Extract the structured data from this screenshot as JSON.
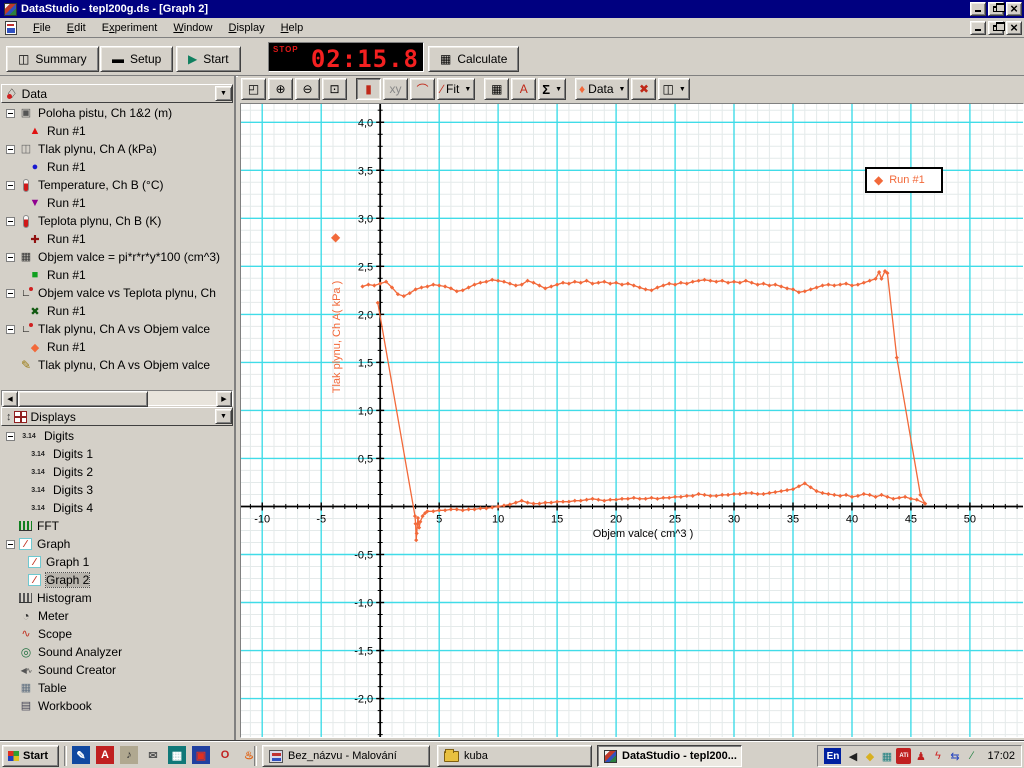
{
  "window": {
    "title": "DataStudio - tepl200g.ds - [Graph 2]"
  },
  "menu": {
    "items": [
      "File",
      "Edit",
      "Experiment",
      "Window",
      "Display",
      "Help"
    ]
  },
  "toolbar": {
    "summary_label": "Summary",
    "setup_label": "Setup",
    "start_label": "Start",
    "calculate_label": "Calculate",
    "timer": {
      "mode": "STOP",
      "value": "02:15.8"
    }
  },
  "graph_toolbar": {
    "fit_label": "Fit",
    "data_label": "Data",
    "buttons": [
      {
        "name": "scale-to-fit-button"
      },
      {
        "name": "zoom-in-button"
      },
      {
        "name": "zoom-out-button"
      },
      {
        "name": "zoom-select-button"
      },
      {
        "name": "smart-tool-button",
        "pressed": true,
        "gap": true
      },
      {
        "name": "xy-tool-button",
        "disabled": true
      },
      {
        "name": "slope-tool-button"
      },
      {
        "name": "fit-dropdown",
        "dropdown": true,
        "label_key": "fit_label"
      },
      {
        "name": "calculate-tool-button",
        "gap": true
      },
      {
        "name": "text-tool-button"
      },
      {
        "name": "statistics-dropdown",
        "dropdown": true
      },
      {
        "name": "data-dropdown",
        "dropdown": true,
        "label_key": "data_label",
        "gap": true
      },
      {
        "name": "delete-button"
      },
      {
        "name": "settings-dropdown",
        "dropdown": true
      }
    ]
  },
  "sidebar": {
    "data_panel": {
      "title": "Data",
      "tree": [
        {
          "icon": "motion-sensor",
          "label": "Poloha pistu, Ch 1&2 (m)",
          "runs": [
            {
              "marker": "triangle-up",
              "color": "#e01010",
              "label": "Run #1"
            }
          ]
        },
        {
          "icon": "pressure-sensor",
          "label": "Tlak plynu, Ch A (kPa)",
          "runs": [
            {
              "marker": "circle",
              "color": "#1818d0",
              "label": "Run #1"
            }
          ]
        },
        {
          "icon": "thermometer",
          "label": "Temperature, Ch B (°C)",
          "runs": [
            {
              "marker": "triangle-down",
              "color": "#900090",
              "label": "Run #1"
            }
          ]
        },
        {
          "icon": "thermometer",
          "label": "Teplota plynu, Ch B (K)",
          "runs": [
            {
              "marker": "plus",
              "color": "#901010",
              "label": "Run #1"
            }
          ]
        },
        {
          "icon": "calculator",
          "label": "Objem valce = pi*r*r*y*100 (cm^3)",
          "runs": [
            {
              "marker": "square",
              "color": "#10a020",
              "label": "Run #1"
            }
          ]
        },
        {
          "icon": "xy-plot",
          "label": "Objem valce vs Teplota plynu, Ch",
          "runs": [
            {
              "marker": "x",
              "color": "#105810",
              "label": "Run #1"
            }
          ]
        },
        {
          "icon": "xy-plot",
          "label": "Tlak plynu, Ch A vs Objem valce",
          "runs": [
            {
              "marker": "diamond",
              "color": "#f2693a",
              "label": "Run #1"
            }
          ]
        },
        {
          "icon": "pencil",
          "label": "Tlak plynu, Ch A vs Objem valce",
          "runs": []
        }
      ]
    },
    "displays_panel": {
      "title": "Displays",
      "tree": [
        {
          "icon": "digits",
          "label": "Digits",
          "children": [
            "Digits 1",
            "Digits 2",
            "Digits 3",
            "Digits 4"
          ]
        },
        {
          "icon": "fft",
          "label": "FFT"
        },
        {
          "icon": "graph",
          "label": "Graph",
          "children": [
            "Graph 1",
            "Graph 2"
          ],
          "selected_child": "Graph 2"
        },
        {
          "icon": "histogram",
          "label": "Histogram"
        },
        {
          "icon": "meter",
          "label": "Meter"
        },
        {
          "icon": "scope",
          "label": "Scope"
        },
        {
          "icon": "sound-analyzer",
          "label": "Sound Analyzer"
        },
        {
          "icon": "sound-creator",
          "label": "Sound Creator"
        },
        {
          "icon": "table",
          "label": "Table"
        },
        {
          "icon": "workbook",
          "label": "Workbook"
        }
      ]
    }
  },
  "chart_data": {
    "type": "scatter",
    "title": "",
    "xlabel": "Objem valce( cm^3 )",
    "ylabel": "Tlak plynu, Ch A( kPa )",
    "xlim": [
      -11.8,
      54.5
    ],
    "ylim": [
      -2.4,
      4.19
    ],
    "x_ticks": {
      "values": [
        -10,
        -5,
        5,
        10,
        15,
        20,
        25,
        30,
        35,
        40,
        45,
        50
      ],
      "labels": [
        "-10",
        "-5",
        "5",
        "10",
        "15",
        "20",
        "25",
        "30",
        "35",
        "40",
        "45",
        "50"
      ]
    },
    "y_ticks": {
      "values": [
        4,
        3.5,
        3,
        2.5,
        2,
        1.5,
        1,
        0.5,
        -0.5,
        -1,
        -1.5,
        -2
      ],
      "labels": [
        "4,0",
        "3,5",
        "3,0",
        "2,5",
        "2,0",
        "1,5",
        "1,0",
        "0,5",
        "-0,5",
        "-1,0",
        "-1,5",
        "-2,0"
      ]
    },
    "grid": {
      "x_major_step": 5,
      "x_minor_step": 1,
      "y_major_step": 0.5,
      "y_minor_step": 0.125,
      "major_color": "#40dce8",
      "minor_color": "#e4eaea"
    },
    "legend": {
      "label": "Run #1",
      "position": "top-right"
    },
    "series": [
      {
        "name": "Run #1",
        "color": "#f2693a",
        "marker": "diamond",
        "points": [
          [
            -1.5,
            2.29
          ],
          [
            -1.0,
            2.31
          ],
          [
            -0.5,
            2.3
          ],
          [
            0.0,
            2.32
          ],
          [
            0.5,
            2.34
          ],
          [
            1.0,
            2.28
          ],
          [
            1.5,
            2.21
          ],
          [
            2.0,
            2.19
          ],
          [
            2.5,
            2.22
          ],
          [
            3.0,
            2.26
          ],
          [
            3.5,
            2.28
          ],
          [
            4.0,
            2.29
          ],
          [
            4.5,
            2.31
          ],
          [
            5.0,
            2.3
          ],
          [
            5.5,
            2.29
          ],
          [
            6.0,
            2.27
          ],
          [
            6.5,
            2.24
          ],
          [
            7.0,
            2.25
          ],
          [
            7.5,
            2.28
          ],
          [
            8.0,
            2.31
          ],
          [
            8.5,
            2.33
          ],
          [
            9.0,
            2.34
          ],
          [
            9.5,
            2.36
          ],
          [
            10.0,
            2.35
          ],
          [
            10.5,
            2.34
          ],
          [
            11.0,
            2.32
          ],
          [
            11.5,
            2.3
          ],
          [
            12.0,
            2.31
          ],
          [
            12.5,
            2.35
          ],
          [
            13.0,
            2.33
          ],
          [
            13.5,
            2.3
          ],
          [
            14.0,
            2.27
          ],
          [
            14.5,
            2.29
          ],
          [
            15.0,
            2.31
          ],
          [
            15.5,
            2.33
          ],
          [
            16.0,
            2.32
          ],
          [
            16.5,
            2.34
          ],
          [
            17.0,
            2.33
          ],
          [
            17.5,
            2.35
          ],
          [
            18.0,
            2.32
          ],
          [
            18.5,
            2.33
          ],
          [
            19.0,
            2.34
          ],
          [
            19.5,
            2.32
          ],
          [
            20.0,
            2.33
          ],
          [
            20.5,
            2.31
          ],
          [
            21.0,
            2.32
          ],
          [
            21.5,
            2.3
          ],
          [
            22.0,
            2.28
          ],
          [
            22.5,
            2.26
          ],
          [
            23.0,
            2.25
          ],
          [
            23.5,
            2.28
          ],
          [
            24.0,
            2.3
          ],
          [
            24.5,
            2.32
          ],
          [
            25.0,
            2.31
          ],
          [
            25.5,
            2.33
          ],
          [
            26.0,
            2.32
          ],
          [
            26.5,
            2.34
          ],
          [
            27.0,
            2.35
          ],
          [
            27.5,
            2.36
          ],
          [
            28.0,
            2.35
          ],
          [
            28.5,
            2.34
          ],
          [
            29.0,
            2.35
          ],
          [
            29.5,
            2.33
          ],
          [
            30.0,
            2.34
          ],
          [
            30.5,
            2.33
          ],
          [
            31.0,
            2.35
          ],
          [
            31.5,
            2.33
          ],
          [
            32.0,
            2.31
          ],
          [
            32.5,
            2.32
          ],
          [
            33.0,
            2.3
          ],
          [
            33.5,
            2.31
          ],
          [
            34.0,
            2.29
          ],
          [
            34.5,
            2.27
          ],
          [
            35.0,
            2.26
          ],
          [
            35.5,
            2.23
          ],
          [
            36.0,
            2.24
          ],
          [
            36.5,
            2.26
          ],
          [
            37.0,
            2.28
          ],
          [
            37.5,
            2.3
          ],
          [
            38.0,
            2.31
          ],
          [
            38.5,
            2.3
          ],
          [
            39.0,
            2.31
          ],
          [
            39.5,
            2.32
          ],
          [
            40.0,
            2.3
          ],
          [
            40.5,
            2.31
          ],
          [
            41.0,
            2.33
          ],
          [
            41.5,
            2.35
          ],
          [
            42.0,
            2.37
          ],
          [
            42.3,
            2.44
          ],
          [
            42.5,
            2.37
          ],
          [
            42.8,
            2.45
          ],
          [
            43.0,
            2.43
          ],
          [
            43.8,
            1.55
          ],
          [
            45.8,
            0.12
          ],
          [
            46.2,
            0.03
          ],
          [
            45.5,
            0.07
          ],
          [
            45.0,
            0.08
          ],
          [
            44.5,
            0.1
          ],
          [
            44.0,
            0.09
          ],
          [
            43.5,
            0.08
          ],
          [
            43.0,
            0.1
          ],
          [
            42.5,
            0.12
          ],
          [
            42.0,
            0.1
          ],
          [
            41.5,
            0.12
          ],
          [
            41.0,
            0.13
          ],
          [
            40.5,
            0.11
          ],
          [
            40.0,
            0.1
          ],
          [
            39.5,
            0.12
          ],
          [
            39.0,
            0.11
          ],
          [
            38.5,
            0.12
          ],
          [
            38.0,
            0.13
          ],
          [
            37.5,
            0.14
          ],
          [
            37.0,
            0.16
          ],
          [
            36.5,
            0.2
          ],
          [
            36.0,
            0.24
          ],
          [
            35.5,
            0.21
          ],
          [
            35.0,
            0.18
          ],
          [
            34.5,
            0.17
          ],
          [
            34.0,
            0.16
          ],
          [
            33.5,
            0.15
          ],
          [
            33.0,
            0.14
          ],
          [
            32.5,
            0.13
          ],
          [
            32.0,
            0.13
          ],
          [
            31.5,
            0.14
          ],
          [
            31.0,
            0.14
          ],
          [
            30.5,
            0.13
          ],
          [
            30.0,
            0.13
          ],
          [
            29.5,
            0.12
          ],
          [
            29.0,
            0.12
          ],
          [
            28.5,
            0.11
          ],
          [
            28.0,
            0.11
          ],
          [
            27.5,
            0.12
          ],
          [
            27.0,
            0.13
          ],
          [
            26.5,
            0.11
          ],
          [
            26.0,
            0.11
          ],
          [
            25.5,
            0.1
          ],
          [
            25.0,
            0.1
          ],
          [
            24.5,
            0.09
          ],
          [
            24.0,
            0.09
          ],
          [
            23.5,
            0.08
          ],
          [
            23.0,
            0.09
          ],
          [
            22.5,
            0.08
          ],
          [
            22.0,
            0.08
          ],
          [
            21.5,
            0.09
          ],
          [
            21.0,
            0.08
          ],
          [
            20.5,
            0.08
          ],
          [
            20.0,
            0.07
          ],
          [
            19.5,
            0.07
          ],
          [
            19.0,
            0.06
          ],
          [
            18.5,
            0.07
          ],
          [
            18.0,
            0.08
          ],
          [
            17.5,
            0.07
          ],
          [
            17.0,
            0.06
          ],
          [
            16.5,
            0.06
          ],
          [
            16.0,
            0.05
          ],
          [
            15.5,
            0.05
          ],
          [
            15.0,
            0.05
          ],
          [
            14.5,
            0.04
          ],
          [
            14.0,
            0.04
          ],
          [
            13.5,
            0.03
          ],
          [
            13.0,
            0.03
          ],
          [
            12.5,
            0.04
          ],
          [
            12.0,
            0.06
          ],
          [
            11.5,
            0.04
          ],
          [
            11.0,
            0.02
          ],
          [
            10.5,
            0.01
          ],
          [
            10.0,
            0.0
          ],
          [
            9.5,
            -0.01
          ],
          [
            9.0,
            -0.02
          ],
          [
            8.5,
            -0.02
          ],
          [
            8.0,
            -0.03
          ],
          [
            7.5,
            -0.03
          ],
          [
            7.0,
            -0.04
          ],
          [
            6.5,
            -0.03
          ],
          [
            6.0,
            -0.03
          ],
          [
            5.5,
            -0.04
          ],
          [
            5.0,
            -0.04
          ],
          [
            4.5,
            -0.05
          ],
          [
            4.0,
            -0.05
          ],
          [
            3.8,
            -0.07
          ],
          [
            3.6,
            -0.1
          ],
          [
            3.4,
            -0.16
          ],
          [
            3.3,
            -0.22
          ],
          [
            3.2,
            -0.12
          ],
          [
            3.1,
            -0.28
          ],
          [
            3.05,
            -0.35
          ],
          [
            3.0,
            -0.18
          ],
          [
            2.95,
            -0.1
          ],
          [
            -0.2,
            2.12
          ]
        ]
      }
    ]
  },
  "taskbar": {
    "start_label": "Start",
    "quick_launch": [
      "wordpad",
      "acrobat",
      "media-player",
      "mail",
      "calculator-app",
      "dragon-app",
      "opera",
      "flame-app"
    ],
    "tasks": [
      {
        "icon": "paint",
        "label": "Bez_názvu - Malování",
        "active": false
      },
      {
        "icon": "folder",
        "label": "kuba",
        "active": false
      },
      {
        "icon": "datastudio",
        "label": "DataStudio - tepl200...",
        "active": true
      }
    ],
    "tray": {
      "keyboard_layout": "En",
      "icons": [
        "volume",
        "diamond-tool",
        "scheduler",
        "ati",
        "agent",
        "power",
        "sync",
        "pen"
      ],
      "clock": "17:02"
    }
  }
}
